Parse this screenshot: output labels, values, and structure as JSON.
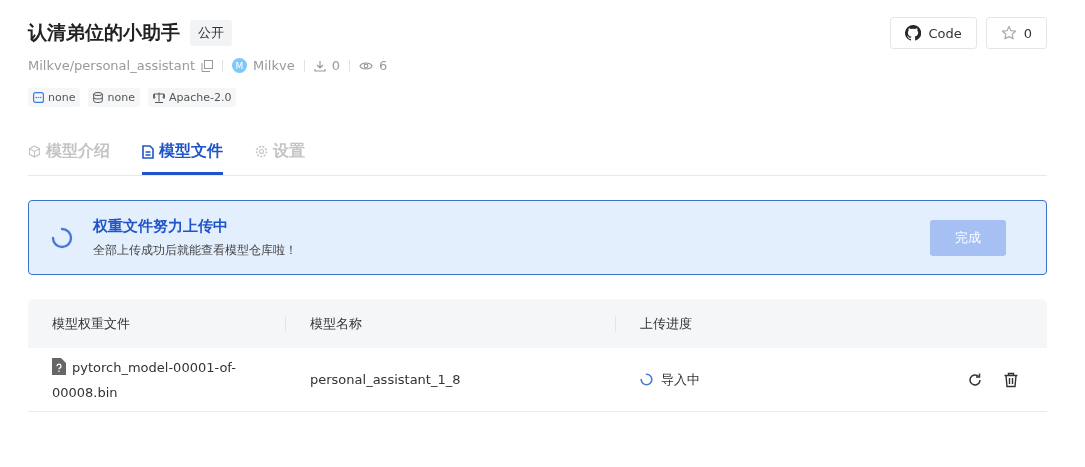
{
  "header": {
    "title": "认清弟位的小助手",
    "visibility": "公开",
    "repo_path": "Milkve/personal_assistant",
    "owner": {
      "initial": "M",
      "name": "Milkve"
    },
    "downloads": "0",
    "views": "6",
    "code_button": "Code",
    "stars_count": "0"
  },
  "tags": [
    "none",
    "none",
    "Apache-2.0"
  ],
  "tabs": [
    {
      "label": "模型介绍",
      "selected": false
    },
    {
      "label": "模型文件",
      "selected": true
    },
    {
      "label": "设置",
      "selected": false
    }
  ],
  "banner": {
    "title": "权重文件努力上传中",
    "message": "全部上传成功后就能查看模型仓库啦！",
    "done_button": {
      "label": "完成",
      "disabled": true
    }
  },
  "table": {
    "columns": [
      "模型权重文件",
      "模型名称",
      "上传进度"
    ],
    "rows": [
      {
        "file": "pytorch_model-00001-of-00008.bin",
        "model_name": "personal_assistant_1_8",
        "status": "导入中"
      }
    ]
  }
}
